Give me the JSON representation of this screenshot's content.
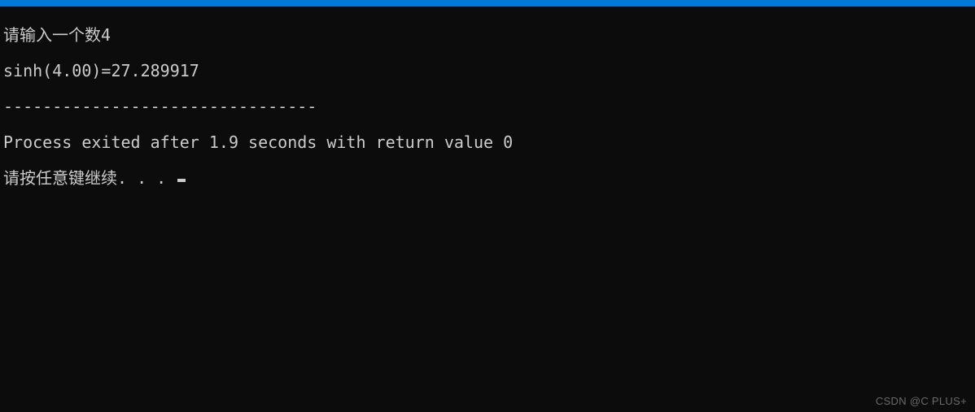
{
  "terminal": {
    "lines": {
      "prompt_input": "请输入一个数4",
      "result": "sinh(4.00)=27.289917",
      "separator": "--------------------------------",
      "process_exit": "Process exited after 1.9 seconds with return value 0",
      "press_key": "请按任意键继续. . . "
    }
  },
  "watermark": "CSDN @C PLUS+"
}
